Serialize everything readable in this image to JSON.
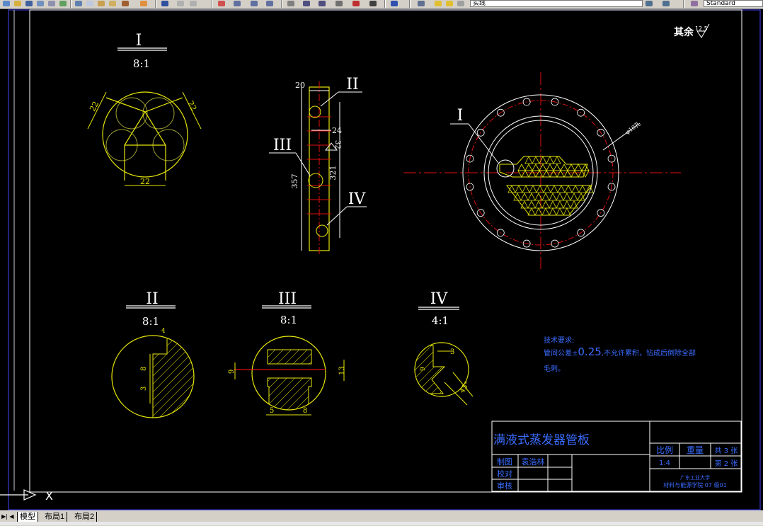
{
  "toolbar": {
    "layer_name": "实线",
    "textstyle_name": "Standard",
    "colors": {
      "bg": "#d4d0c8"
    }
  },
  "drawing": {
    "roughness_note": {
      "label": "其余",
      "value": "12.5"
    },
    "detail_I": {
      "title": "I",
      "scale": "8:1",
      "dims": [
        "22",
        "22",
        "22"
      ]
    },
    "main_view": {
      "dims": [
        "20",
        "24",
        "32",
        "357",
        "321"
      ],
      "callouts": [
        "II",
        "III",
        "IV"
      ]
    },
    "plan_view": {
      "callout": "I",
      "hole_note": "φ10孔"
    },
    "detail_II": {
      "title": "II",
      "scale": "8:1",
      "dims": [
        "4",
        "8",
        "3"
      ]
    },
    "detail_III": {
      "title": "III",
      "scale": "8:1",
      "dims": [
        "9",
        "13",
        "5",
        "8"
      ]
    },
    "detail_IV": {
      "title": "IV",
      "scale": "4:1",
      "dims": [
        "3",
        "9",
        "45°"
      ]
    },
    "tech_requirements": {
      "heading": "技术要求:",
      "line1_prefix": "管间公差±",
      "line1_value": "0.25",
      "line1_suffix": ",不允许累积，钻成后倒除全部",
      "line2": "毛刺。"
    },
    "title_block": {
      "title": "满液式蒸发器管板",
      "scale_label": "比例",
      "weight_label": "重量",
      "sheets_total": "共 3 张",
      "scale_value": "1:4",
      "sheet_no": "第 2 张",
      "drawn_label": "制图",
      "drawn_name": "袁浩林",
      "checked_label": "校对",
      "approved_label": "审核",
      "school": "广东工业大学",
      "code": "材料与能源学院  07 级01"
    },
    "ucs": {
      "x_label": "X"
    }
  },
  "tabs": [
    {
      "label": "模型",
      "active": true
    },
    {
      "label": "布局1",
      "active": false
    },
    {
      "label": "布局2",
      "active": false
    }
  ]
}
